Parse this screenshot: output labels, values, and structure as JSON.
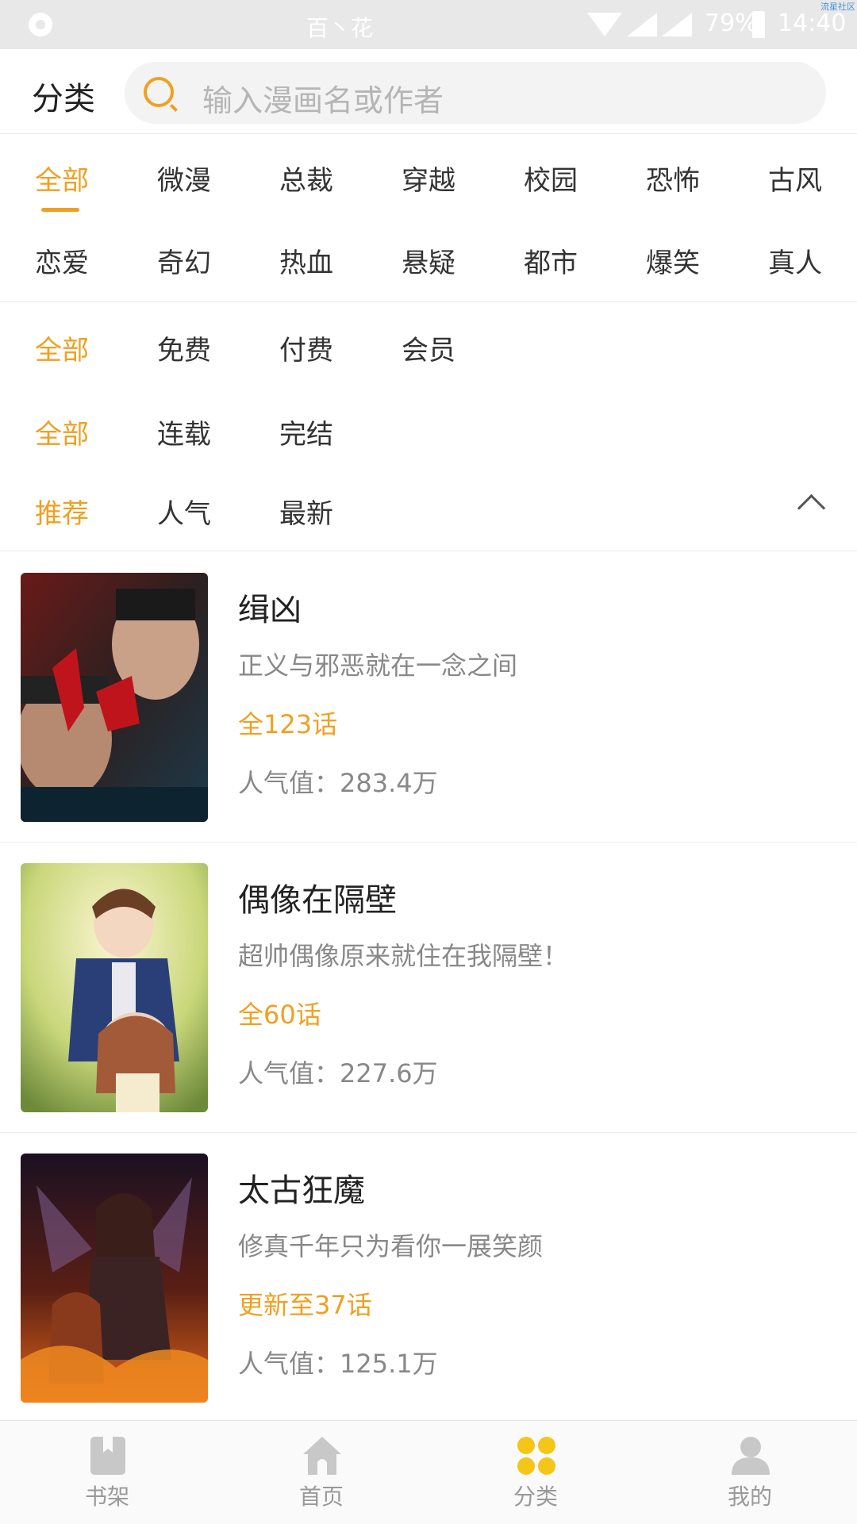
{
  "status_bar": {
    "center_text": "百丶花",
    "battery": "79%",
    "time": "14:40",
    "watermark": "流星社区"
  },
  "header": {
    "title": "分类",
    "search_placeholder": "输入漫画名或作者"
  },
  "filters": {
    "genres_row1": [
      "全部",
      "微漫",
      "总裁",
      "穿越",
      "校园",
      "恐怖",
      "古风"
    ],
    "genres_row2": [
      "恋爱",
      "奇幻",
      "热血",
      "悬疑",
      "都市",
      "爆笑",
      "真人"
    ],
    "price": [
      "全部",
      "免费",
      "付费",
      "会员"
    ],
    "status": [
      "全部",
      "连载",
      "完结"
    ],
    "sort": [
      "推荐",
      "人气",
      "最新"
    ],
    "active_color": "#f0a020"
  },
  "comics": [
    {
      "title": "缉凶",
      "desc": "正义与邪恶就在一念之间",
      "episodes": "全123话",
      "popularity": "人气值：283.4万"
    },
    {
      "title": "偶像在隔壁",
      "desc": "超帅偶像原来就住在我隔壁！",
      "episodes": "全60话",
      "popularity": "人气值：227.6万"
    },
    {
      "title": "太古狂魔",
      "desc": "修真千年只为看你一展笑颜",
      "episodes": "更新至37话",
      "popularity": "人气值：125.1万"
    }
  ],
  "bottom_nav": {
    "items": [
      {
        "label": "书架",
        "icon": "bookshelf-icon"
      },
      {
        "label": "首页",
        "icon": "home-icon"
      },
      {
        "label": "分类",
        "icon": "category-icon"
      },
      {
        "label": "我的",
        "icon": "profile-icon"
      }
    ],
    "active_icon_color": "#f5c518",
    "inactive_icon_color": "#c8c8c8"
  }
}
